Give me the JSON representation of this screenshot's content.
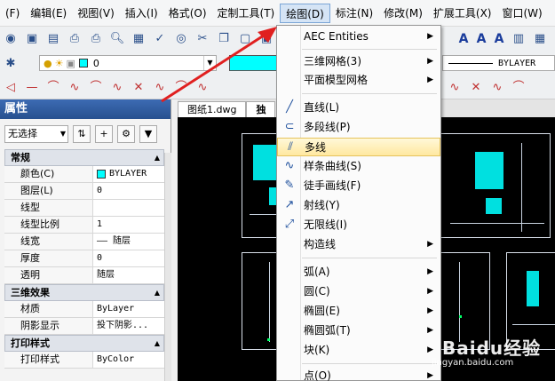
{
  "menubar": {
    "items": [
      "(F)",
      "编辑(E)",
      "视图(V)",
      "插入(I)",
      "格式(O)",
      "定制工具(T)",
      "绘图(D)",
      "标注(N)",
      "修改(M)",
      "扩展工具(X)",
      "窗口(W)"
    ],
    "active": "绘图(D)"
  },
  "toolbar": {
    "layer_value": "0",
    "linetype_value": "BYLAYER",
    "text_icons": [
      "A",
      "A",
      "A"
    ]
  },
  "properties": {
    "title": "属性",
    "selection": "无选择",
    "categories": [
      {
        "name": "常规",
        "rows": [
          {
            "key": "颜色(C)",
            "value": "BYLAYER",
            "swatch": "#00ffff"
          },
          {
            "key": "图层(L)",
            "value": "0"
          },
          {
            "key": "线型",
            "value": ""
          },
          {
            "key": "线型比例",
            "value": "1"
          },
          {
            "key": "线宽",
            "value": "—— 随层"
          },
          {
            "key": "厚度",
            "value": "0"
          },
          {
            "key": "透明",
            "value": "随层"
          }
        ]
      },
      {
        "name": "三维效果",
        "rows": [
          {
            "key": "材质",
            "value": "ByLayer"
          },
          {
            "key": "阴影显示",
            "value": "投下阴影..."
          }
        ]
      },
      {
        "name": "打印样式",
        "rows": [
          {
            "key": "打印样式",
            "value": "ByColor"
          }
        ]
      }
    ]
  },
  "document_tabs": [
    "图纸1.dwg",
    "独"
  ],
  "dropdown": {
    "items": [
      {
        "label": "AEC Entities",
        "submenu": true,
        "icon": ""
      },
      {
        "label": "三维网格(3)",
        "submenu": true,
        "icon": ""
      },
      {
        "label": "平面模型网格",
        "submenu": true,
        "icon": ""
      },
      {
        "label": "直线(L)",
        "submenu": false,
        "icon": "line-icon"
      },
      {
        "label": "多段线(P)",
        "submenu": false,
        "icon": "polyline-icon"
      },
      {
        "label": "多线",
        "submenu": false,
        "icon": "multiline-icon",
        "highlighted": true
      },
      {
        "label": "样条曲线(S)",
        "submenu": false,
        "icon": "spline-icon"
      },
      {
        "label": "徒手画线(F)",
        "submenu": false,
        "icon": "freehand-icon"
      },
      {
        "label": "射线(Y)",
        "submenu": false,
        "icon": "ray-icon"
      },
      {
        "label": "无限线(I)",
        "submenu": false,
        "icon": "xline-icon"
      },
      {
        "label": "构造线",
        "submenu": true,
        "icon": ""
      },
      {
        "label": "弧(A)",
        "submenu": true,
        "icon": ""
      },
      {
        "label": "圆(C)",
        "submenu": true,
        "icon": ""
      },
      {
        "label": "椭圆(E)",
        "submenu": true,
        "icon": ""
      },
      {
        "label": "椭圆弧(T)",
        "submenu": true,
        "icon": ""
      },
      {
        "label": "块(K)",
        "submenu": true,
        "icon": ""
      },
      {
        "label": "点(O)",
        "submenu": true,
        "icon": ""
      }
    ]
  },
  "watermark": {
    "brand": "Baidu经验",
    "url": "jingyan.baidu.com"
  },
  "colors": {
    "accent_cyan": "#00ffff",
    "annotation_red": "#e02020",
    "highlight": "#ffe8a0"
  }
}
